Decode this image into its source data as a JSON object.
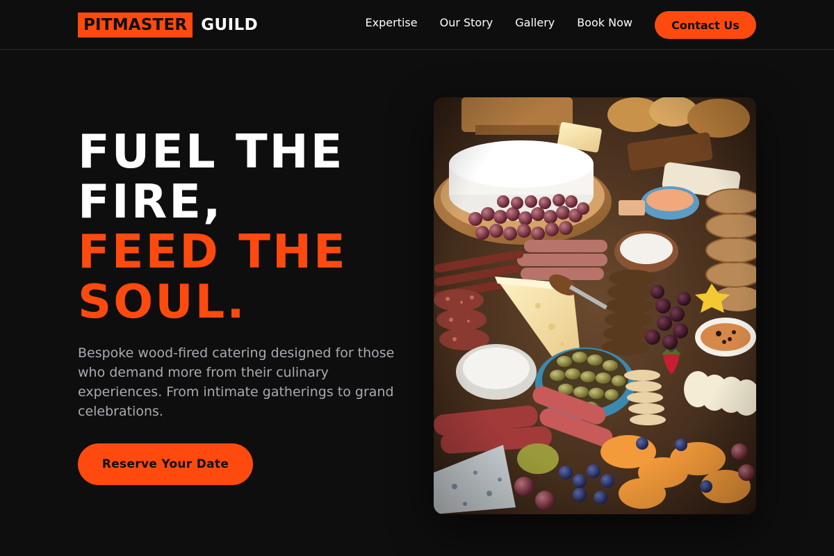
{
  "brand": {
    "name_primary": "PITMASTER",
    "name_secondary": "GUILD"
  },
  "nav": {
    "items": [
      {
        "label": "Expertise"
      },
      {
        "label": "Our Story"
      },
      {
        "label": "Gallery"
      },
      {
        "label": "Book Now"
      }
    ],
    "cta_label": "Contact Us"
  },
  "hero": {
    "headline_lines": [
      "FUEL THE",
      "FIRE,"
    ],
    "headline_accent_lines": [
      "FEED THE",
      "SOUL."
    ],
    "description": "Bespoke wood-fired catering designed for those who demand more from their culinary experiences. From intimate gatherings to grand celebrations.",
    "cta_label": "Reserve Your Date",
    "image": {
      "subject": "charcuterie-platter-photo"
    }
  },
  "colors": {
    "accent": "#ff4a0f",
    "background": "#0e0e0f",
    "muted_text": "#a9abb1"
  }
}
